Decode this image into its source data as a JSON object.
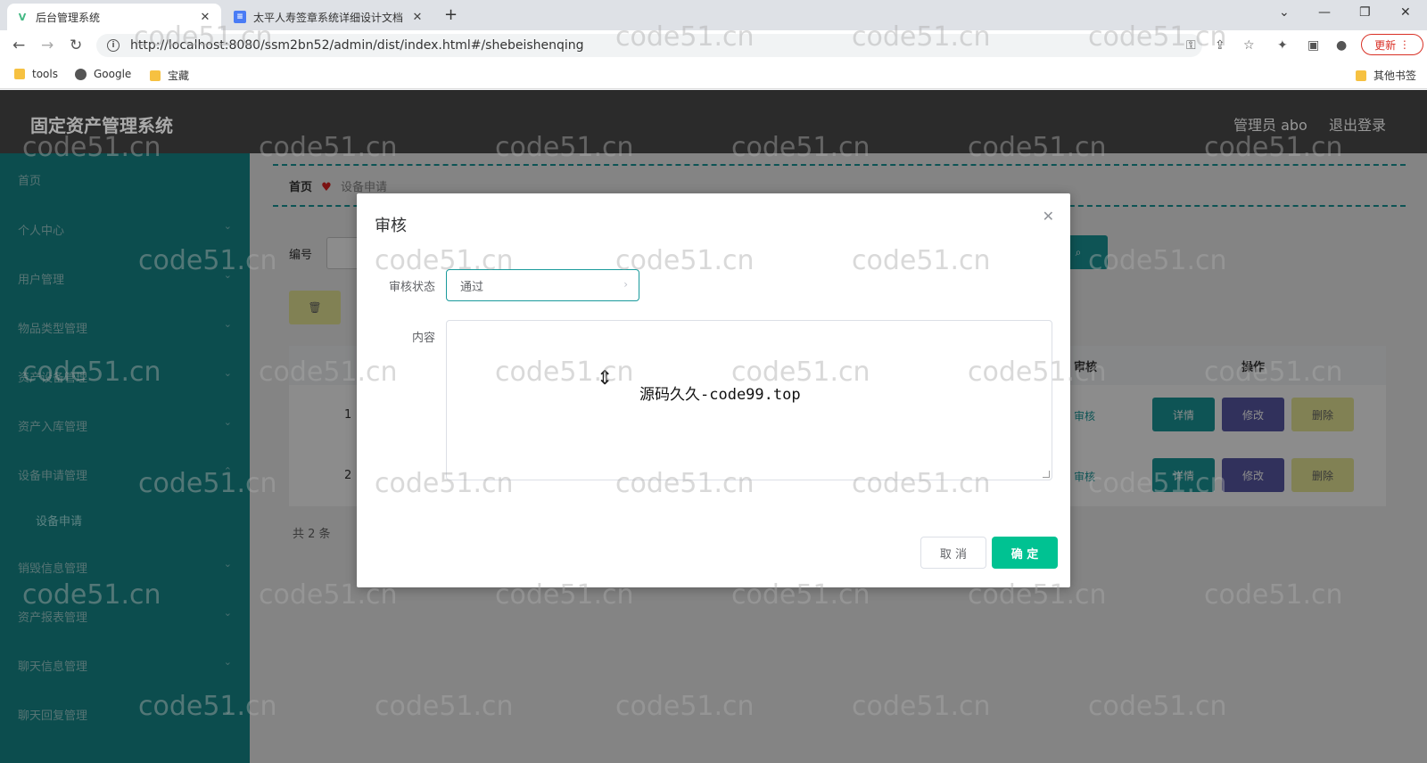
{
  "browser": {
    "tabs": [
      {
        "title": "后台管理系统",
        "active": true
      },
      {
        "title": "太平人寿签章系统详细设计文档",
        "active": false
      }
    ],
    "url": "http://localhost:8080/ssm2bn52/admin/dist/index.html#/shebeishenqing",
    "update_label": "更新",
    "bookmarks": [
      "tools",
      "Google",
      "宝藏"
    ],
    "other_bookmarks": "其他书签"
  },
  "app": {
    "title": "固定资产管理系统",
    "user": "管理员 abo",
    "logout": "退出登录"
  },
  "sidebar": {
    "items": [
      {
        "label": "首页"
      },
      {
        "label": "个人中心"
      },
      {
        "label": "用户管理"
      },
      {
        "label": "物品类型管理"
      },
      {
        "label": "资产设备管理"
      },
      {
        "label": "资产入库管理"
      },
      {
        "label": "设备申请管理"
      },
      {
        "label": "设备申请"
      },
      {
        "label": "销毁信息管理"
      },
      {
        "label": "资产报表管理"
      },
      {
        "label": "聊天信息管理"
      },
      {
        "label": "聊天回复管理"
      }
    ]
  },
  "breadcrumb": {
    "home": "首页",
    "sep": "♥",
    "current": "设备申请"
  },
  "background": {
    "filter_label": "编号",
    "table": {
      "headers": [
        "审核",
        "操作"
      ],
      "rows": [
        {
          "index": "1",
          "audit": "审核",
          "detail": "详情",
          "edit": "修改",
          "delete": "删除"
        },
        {
          "index": "2",
          "audit": "审核",
          "detail": "详情",
          "edit": "修改",
          "delete": "删除"
        }
      ]
    },
    "total": "共 2 条"
  },
  "dialog": {
    "title": "审核",
    "status_label": "审核状态",
    "status_value": "通过",
    "content_label": "内容",
    "content_text": "源码久久-code99.top",
    "cancel": "取 消",
    "confirm": "确 定"
  },
  "watermark": "code51.cn"
}
